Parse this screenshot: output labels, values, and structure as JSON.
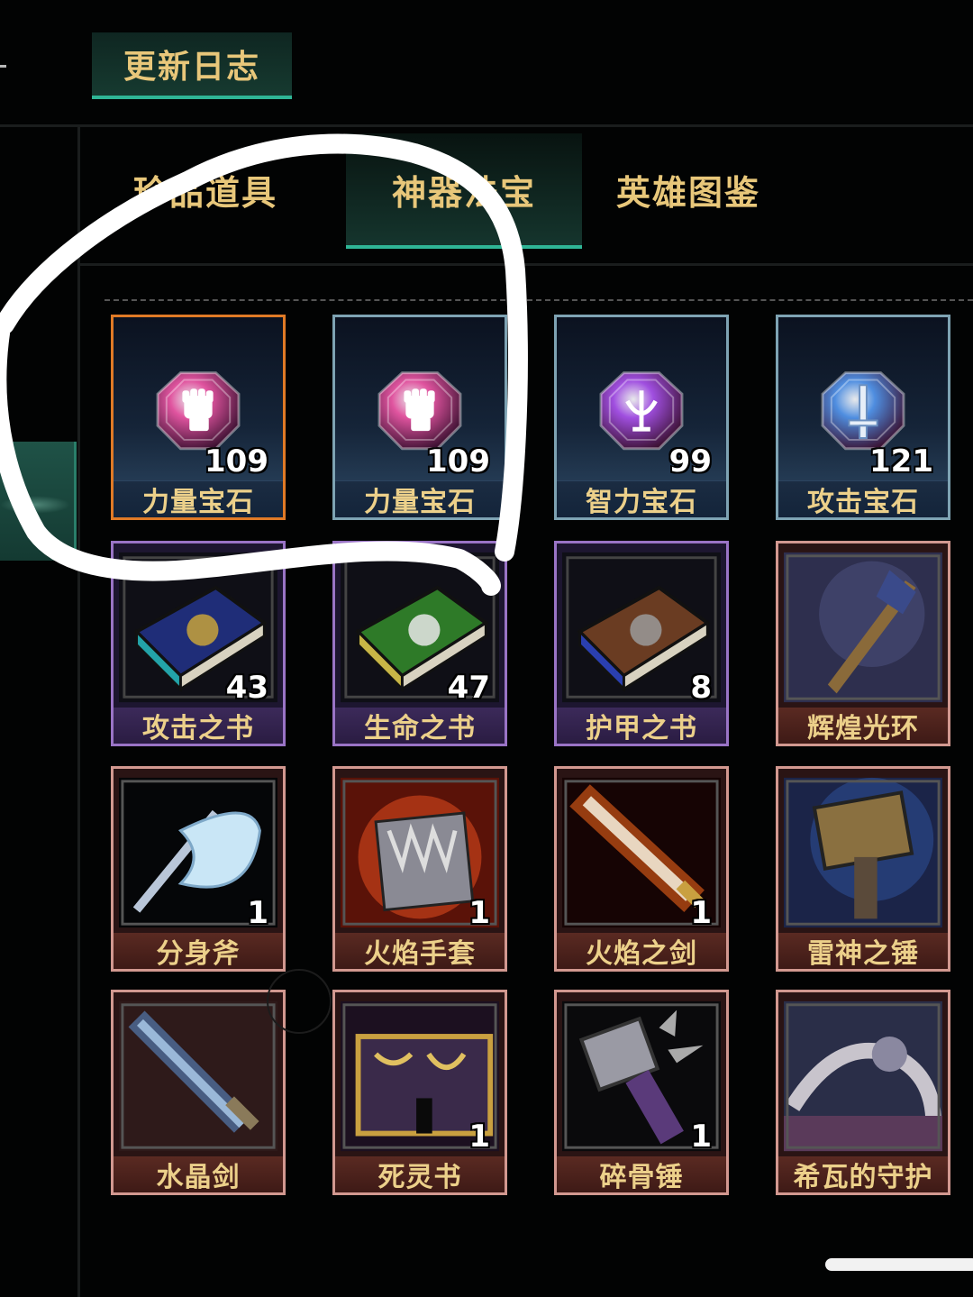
{
  "top_tabs": [
    {
      "label": "更新日志",
      "active": true
    }
  ],
  "sub_tabs": [
    {
      "label": "珍品道具",
      "active": false
    },
    {
      "label": "神器法宝",
      "active": true
    },
    {
      "label": "英雄图鉴",
      "active": false
    }
  ],
  "items": [
    {
      "name": "力量宝石",
      "count": "109",
      "rarity": "gem",
      "icon": "strength-gem-fist-icon",
      "color": "#e0549f"
    },
    {
      "name": "力量宝石",
      "count": "109",
      "rarity": "gem",
      "icon": "strength-gem-fist-icon",
      "color": "#e0549f"
    },
    {
      "name": "智力宝石",
      "count": "99",
      "rarity": "gem",
      "icon": "intelligence-gem-rune-icon",
      "color": "#a04fe0"
    },
    {
      "name": "攻击宝石",
      "count": "121",
      "rarity": "gem",
      "icon": "attack-gem-sword-icon",
      "color": "#4f8ee0"
    },
    {
      "name": "攻击之书",
      "count": "43",
      "rarity": "epic",
      "icon": "blue-book-icon"
    },
    {
      "name": "生命之书",
      "count": "47",
      "rarity": "epic",
      "icon": "green-skull-book-icon"
    },
    {
      "name": "护甲之书",
      "count": "8",
      "rarity": "epic",
      "icon": "brown-armor-book-icon"
    },
    {
      "name": "辉煌光环",
      "count": "",
      "rarity": "legend",
      "icon": "radiant-scepter-icon"
    },
    {
      "name": "分身斧",
      "count": "1",
      "rarity": "legend",
      "icon": "ice-axe-icon"
    },
    {
      "name": "火焰手套",
      "count": "1",
      "rarity": "legend",
      "icon": "flame-gauntlet-icon"
    },
    {
      "name": "火焰之剑",
      "count": "1",
      "rarity": "legend",
      "icon": "flame-sword-icon"
    },
    {
      "name": "雷神之锤",
      "count": "",
      "rarity": "legend",
      "icon": "thunder-hammer-icon"
    },
    {
      "name": "水晶剑",
      "count": "",
      "rarity": "legend",
      "icon": "crystal-sword-icon"
    },
    {
      "name": "死灵书",
      "count": "1",
      "rarity": "legend",
      "icon": "necronomicon-icon"
    },
    {
      "name": "碎骨锤",
      "count": "1",
      "rarity": "legend",
      "icon": "spiked-mace-icon"
    },
    {
      "name": "希瓦的守护",
      "count": "",
      "rarity": "legend",
      "icon": "shivas-guard-icon"
    }
  ],
  "selected_index": 0
}
